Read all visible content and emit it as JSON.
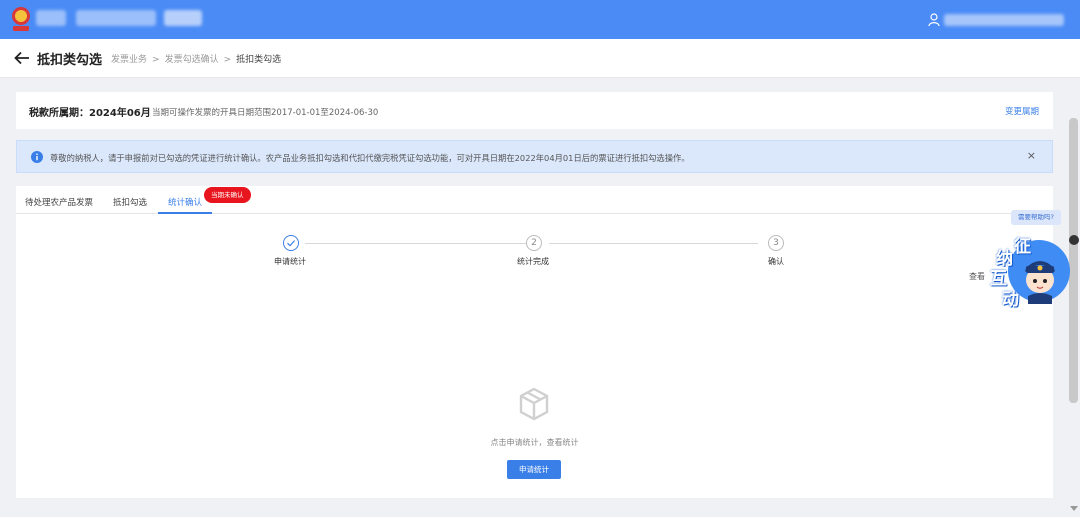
{
  "header": {
    "page_title": "抵扣类勾选",
    "breadcrumb": [
      "发票业务",
      "发票勾选确认",
      "抵扣类勾选"
    ],
    "breadcrumb_sep": ">"
  },
  "period": {
    "label": "税款所属期：2024年06月",
    "desc": "当期可操作发票的开具日期范围2017-01-01至2024-06-30",
    "change": "变更属期"
  },
  "notice": {
    "text": "尊敬的纳税人，请于申报前对已勾选的凭证进行统计确认。农产品业务抵扣勾选和代扣代缴完税凭证勾选功能，可对开具日期在2022年04月01日后的票证进行抵扣勾选操作。",
    "close": "×"
  },
  "tabs": [
    {
      "label": "待处理农产品发票"
    },
    {
      "label": "抵扣勾选"
    },
    {
      "label": "统计确认"
    }
  ],
  "tab_badge": "当期未确认",
  "steps": [
    {
      "index": "✓",
      "label": "申请统计"
    },
    {
      "index": "2",
      "label": "统计完成"
    },
    {
      "index": "3",
      "label": "确认"
    }
  ],
  "view_link": "查看",
  "empty": {
    "text": "点击申请统计，查看统计",
    "button": "申请统计"
  },
  "help": {
    "tip": "需要帮助吗?",
    "mascot_chars": [
      "征",
      "纳",
      "互",
      "动"
    ]
  },
  "colors": {
    "topbar": "#4a8bf6",
    "accent": "#3a7fe8",
    "badge": "#e8141e"
  }
}
